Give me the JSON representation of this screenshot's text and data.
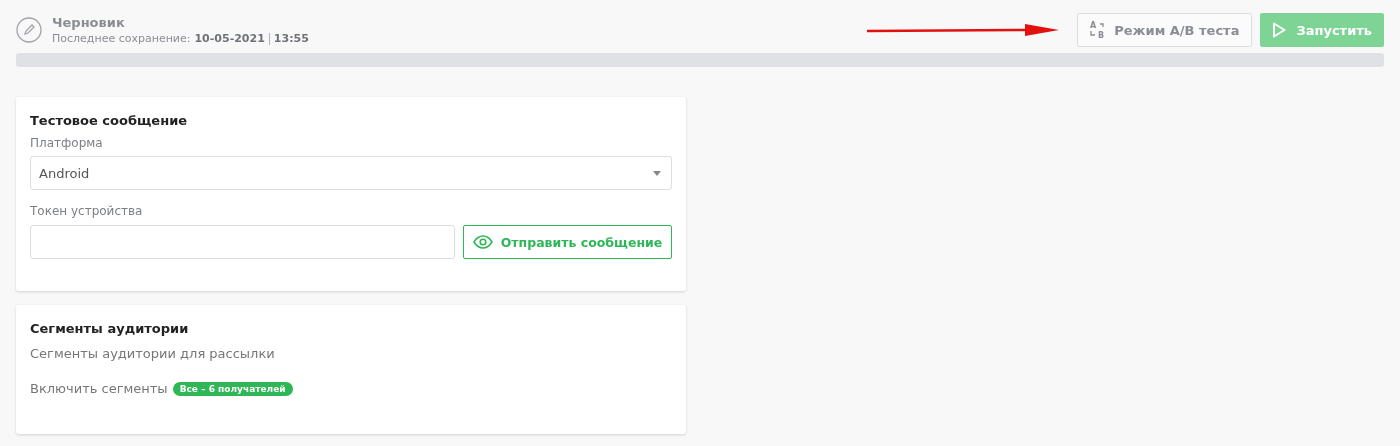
{
  "header": {
    "title": "Черновик",
    "save_label": "Последнее сохранение:",
    "save_date": "10-05-2021",
    "save_time": "13:55"
  },
  "annotation": {
    "kind": "arrow"
  },
  "actions": [
    {
      "kind": "ab",
      "label": "Режим A/B теста",
      "icon_letters": [
        "A",
        "B"
      ],
      "disabled": false
    },
    {
      "kind": "launch",
      "label": "Запустить",
      "disabled": true
    }
  ],
  "test_message": {
    "title": "Тестовое сообщение",
    "platform_label": "Платформа",
    "platform_value": "Android",
    "token_label": "Токен устройства",
    "send_button": "Отправить сообщение"
  },
  "segments": {
    "title": "Сегменты аудитории",
    "description": "Сегменты аудитории для рассылки",
    "include_label": "Включить сегменты",
    "badge": "Все – 6 получателей"
  }
}
